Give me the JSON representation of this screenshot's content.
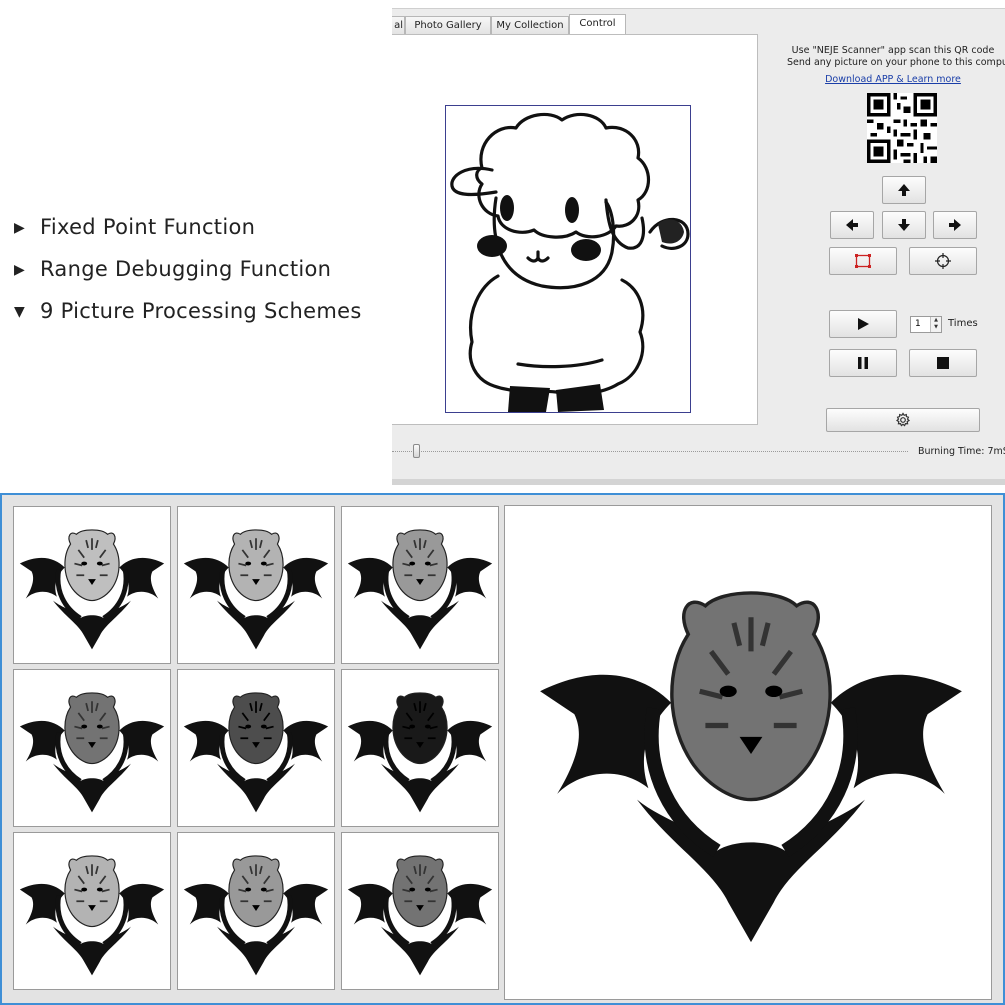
{
  "features": [
    {
      "marker": "▶",
      "label": "Fixed Point Function"
    },
    {
      "marker": "▶",
      "label": "Range Debugging Function"
    },
    {
      "marker": "▼",
      "label": "9 Picture Processing Schemes"
    }
  ],
  "app": {
    "tabs": [
      {
        "label": "al",
        "active": false
      },
      {
        "label": "Photo Gallery",
        "active": false
      },
      {
        "label": "My Collection",
        "active": false
      },
      {
        "label": "Control",
        "active": true
      }
    ],
    "qr_line1": "Use \"NEJE Scanner\" app scan this QR code",
    "qr_line2": "Send any picture on your phone to this computer",
    "download_link": "Download APP & Learn more",
    "controls": {
      "up_icon": "arrow-up-icon",
      "left_icon": "arrow-left-icon",
      "down_icon": "arrow-down-icon",
      "right_icon": "arrow-right-icon",
      "frame_icon": "frame-preview-icon",
      "fixed_point_icon": "crosshair-icon",
      "play_icon": "play-icon",
      "pause_icon": "pause-icon",
      "stop_icon": "stop-icon",
      "settings_icon": "gear-icon"
    },
    "times_value": "1",
    "times_label": "Times",
    "burning_time_label": "Burning Time: 7mS",
    "accent_red": "#cc2222"
  },
  "gallery": {
    "thumbnail_count": 9,
    "thumbnail_darkness": [
      0.25,
      0.3,
      0.4,
      0.55,
      0.7,
      0.9,
      0.3,
      0.4,
      0.55
    ],
    "border_color": "#3f8fd6"
  }
}
